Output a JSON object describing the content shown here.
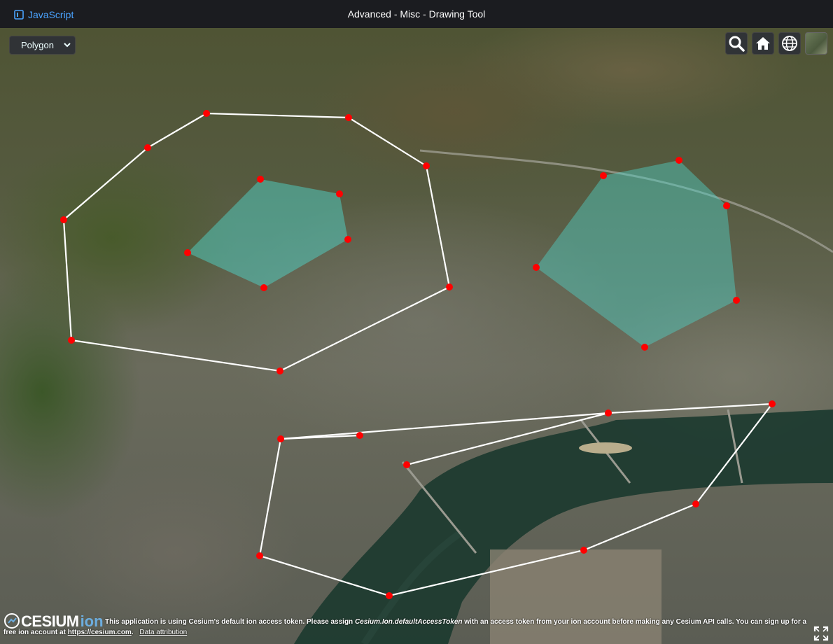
{
  "header": {
    "lang_link": "JavaScript",
    "title": "Advanced - Misc - Drawing Tool"
  },
  "controls": {
    "mode_select_value": "Polygon"
  },
  "toolbar": {
    "buttons": [
      "search-icon",
      "home-icon",
      "globe-icon",
      "imagery-picker-icon"
    ]
  },
  "credits": {
    "logo_text": "CESIUM",
    "logo_suffix": "ion",
    "line1_a": "This application is using Cesium's default ion access token. Please assign ",
    "line1_code": "Cesium.Ion.defaultAccessToken",
    "line1_b": " with an access token from your ion account before making any Cesium API calls. You can sign up for a",
    "line2_a": "free ion account at ",
    "line2_link": "https://cesium.com",
    "line2_b": ".",
    "data_attribution": "Data attribution"
  },
  "colors": {
    "point": "#ff0000",
    "line": "#ffffff",
    "polygon_fill": "#4fd1c5",
    "accent_link": "#4aa3ff"
  }
}
